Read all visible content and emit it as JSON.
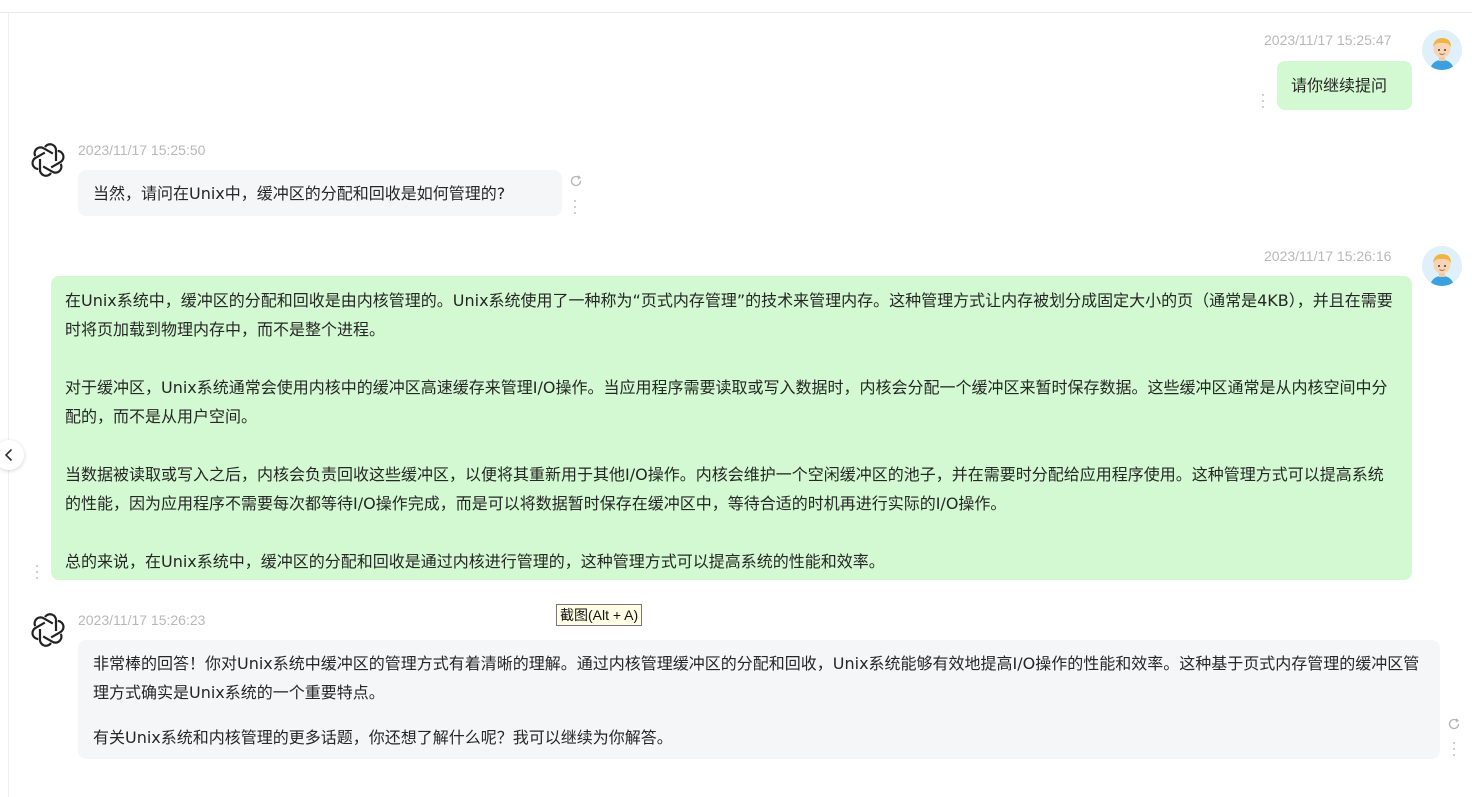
{
  "messages": [
    {
      "role": "user",
      "timestamp": "2023/11/17 15:25:47",
      "paragraphs": [
        "请你继续提问"
      ]
    },
    {
      "role": "assistant",
      "timestamp": "2023/11/17 15:25:50",
      "paragraphs": [
        "当然，请问在Unix中，缓冲区的分配和回收是如何管理的?"
      ]
    },
    {
      "role": "user",
      "timestamp": "2023/11/17 15:26:16",
      "paragraphs": [
        "在Unix系统中，缓冲区的分配和回收是由内核管理的。Unix系统使用了一种称为“页式内存管理”的技术来管理内存。这种管理方式让内存被划分成固定大小的页（通常是4KB），并且在需要时将页加载到物理内存中，而不是整个进程。",
        "对于缓冲区，Unix系统通常会使用内核中的缓冲区高速缓存来管理I/O操作。当应用程序需要读取或写入数据时，内核会分配一个缓冲区来暂时保存数据。这些缓冲区通常是从内核空间中分配的，而不是从用户空间。",
        "当数据被读取或写入之后，内核会负责回收这些缓冲区，以便将其重新用于其他I/O操作。内核会维护一个空闲缓冲区的池子，并在需要时分配给应用程序使用。这种管理方式可以提高系统的性能，因为应用程序不需要每次都等待I/O操作完成，而是可以将数据暂时保存在缓冲区中，等待合适的时机再进行实际的I/O操作。",
        "总的来说，在Unix系统中，缓冲区的分配和回收是通过内核进行管理的，这种管理方式可以提高系统的性能和效率。"
      ]
    },
    {
      "role": "assistant",
      "timestamp": "2023/11/17 15:26:23",
      "paragraphs": [
        "非常棒的回答！你对Unix系统中缓冲区的管理方式有着清晰的理解。通过内核管理缓冲区的分配和回收，Unix系统能够有效地提高I/O操作的性能和效率。这种基于页式内存管理的缓冲区管理方式确实是Unix系统的一个重要特点。",
        "有关Unix系统和内核管理的更多话题，你还想了解什么呢？我可以继续为你解答。"
      ]
    }
  ],
  "tooltip": {
    "text": "截图(Alt + A)"
  },
  "colors": {
    "user_bubble": "#d2f9d1",
    "bot_bubble": "#f4f6f8",
    "timestamp": "#b8b8b8"
  },
  "icons": {
    "user_avatar": "user-avatar-icon",
    "bot_avatar": "openai-logo-icon",
    "more": "more-vertical-icon",
    "regenerate": "refresh-icon",
    "collapse": "chevron-left-icon"
  }
}
